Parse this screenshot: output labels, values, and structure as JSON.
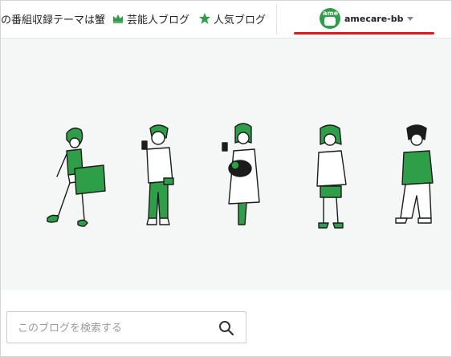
{
  "nav": {
    "theme_link": "の番組収録テーマは蟹",
    "geinin_label": "芸能人ブログ",
    "ninki_label": "人気ブログ",
    "geinin_icon": "crown-icon",
    "ninki_icon": "star-icon"
  },
  "user": {
    "name": "amecare-bb",
    "avatar_text": "ame",
    "avatar_icon": "ameba-avatar-icon"
  },
  "annotation": {
    "color": "#e8141b"
  },
  "hero": {
    "illustration": "people-illustration",
    "accent_color": "#2f9e48"
  },
  "search": {
    "placeholder": "このブログを検索する",
    "value": "",
    "icon": "search-icon"
  },
  "colors": {
    "brand_green": "#2f9e48",
    "hero_bg": "#f5f6f6",
    "annotation_red": "#e8141b"
  }
}
